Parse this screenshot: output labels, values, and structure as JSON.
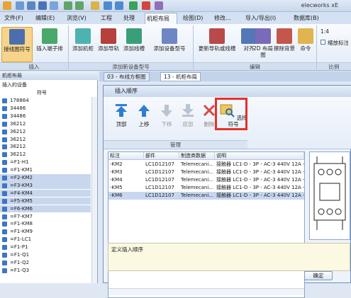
{
  "app": {
    "title": "elecworks xE"
  },
  "tabs": [
    "文件(F)",
    "编辑(E)",
    "浏览(V)",
    "工程",
    "处理",
    "机柜布局",
    "绘图(D)",
    "修改...",
    "导入/导出(I)",
    "数据库(B)"
  ],
  "ribbon": {
    "buttons": [
      "接线图符号",
      "插入端子排",
      "添加机柜",
      "添加导轨",
      "添加线槽",
      "添加设备型号",
      "更新导轨或线槽",
      "对齐",
      "2D 布局图",
      "擦除背景",
      "命令"
    ],
    "groups": [
      "插入",
      "添加新设备型号",
      "编辑",
      "比例"
    ],
    "scale_value": "1:4",
    "scale_check_label": "缩放标注"
  },
  "left_panel": {
    "title": "机柜布局",
    "tree_label": "插入的设备",
    "col_header": "符号",
    "rows": [
      "178864",
      "34486",
      "34486",
      "36212",
      "36212",
      "36212",
      "36212",
      "36212",
      "=F1-H1",
      "=F1-KM1",
      "=F2-KM2",
      "=F3-KM3",
      "=F4-KM4",
      "=F5-KM5",
      "=F6-KM6",
      "=F7-KM7",
      "=F1-KM8",
      "=F1-KM9",
      "=F1-LC1",
      "=F1-P1",
      "=F1-Q1",
      "=F1-Q2",
      "=F1-Q3"
    ],
    "selected": [
      10,
      11,
      12,
      13,
      14
    ]
  },
  "doc_tabs": [
    "03 - 布线方框图",
    "13 - 机柜布局"
  ],
  "dialog": {
    "title": "插入顺序",
    "toolbar": [
      "顶部",
      "上移",
      "下移",
      "底部",
      "删除",
      "选择符号"
    ],
    "group_label": "管理",
    "columns": [
      "标注",
      "部件",
      "制造商数据",
      "说明"
    ],
    "rows": [
      [
        "-KM2",
        "LC1D12107",
        "Telemecani...",
        "接触器 LC1-D - 3P - AC-3 440V 12A - 线圈"
      ],
      [
        "-KM3",
        "LC1D12107",
        "Telemecani...",
        "接触器 LC1-D - 3P - AC-3 440V 12A - 线圈"
      ],
      [
        "-KM4",
        "LC1D12107",
        "Telemecani...",
        "接触器 LC1-D - 3P - AC-3 440V 12A - 线圈"
      ],
      [
        "-KM5",
        "LC1D12107",
        "Telemecani...",
        "接触器 LC1-D - 3P - AC-3 440V 12A - 线圈"
      ],
      [
        "-KM6",
        "LC1D12107",
        "Telemecani...",
        "接触器 LC1-D - 3P - AC-3 440V 12A - 线圈"
      ]
    ],
    "selected_row": 4,
    "description": "定义插入顺序",
    "ok": "确定"
  },
  "colors": {
    "highlight": "#e5312b",
    "selection": "#c7d7f0",
    "accent": "#3f76c2"
  }
}
